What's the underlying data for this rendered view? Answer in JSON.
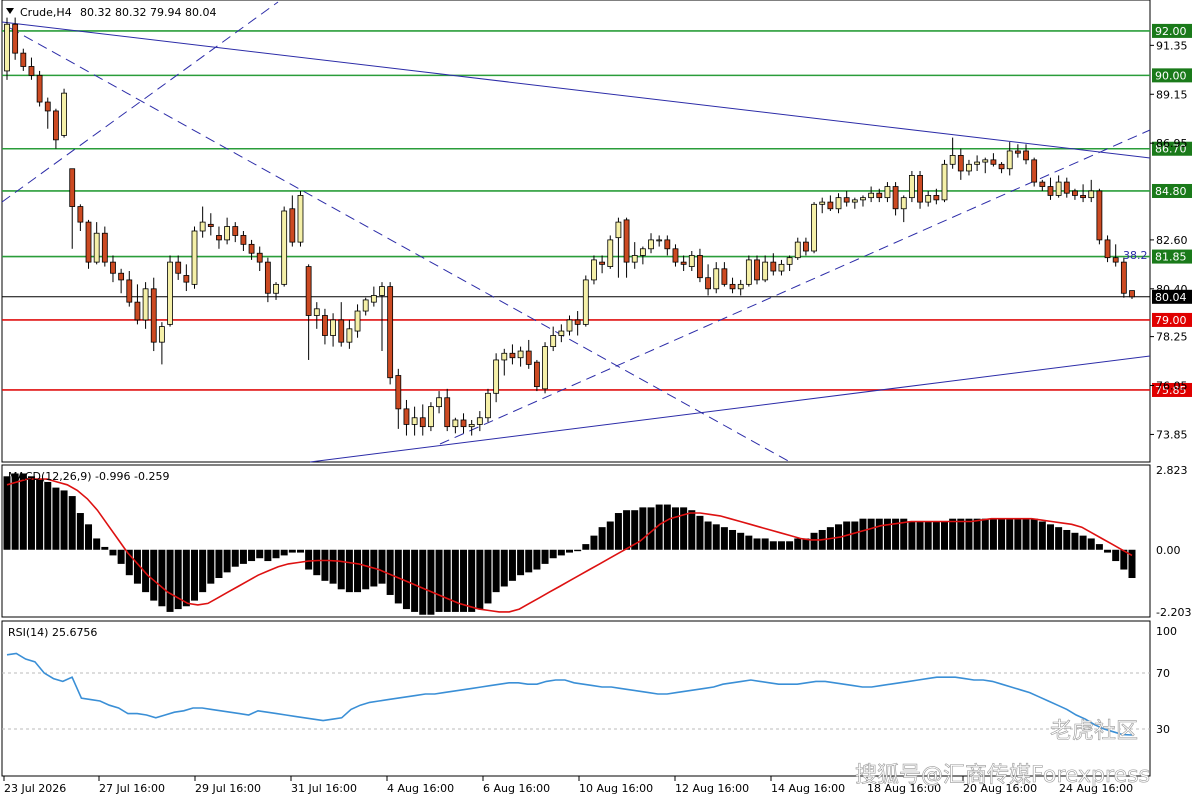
{
  "header": {
    "symbol": "Crude,H4",
    "ohlc": "80.32 80.32 79.94 80.04"
  },
  "colors": {
    "bull": "#f5f0a8",
    "bear": "#cc4a22",
    "support_line": "#2a9d3a",
    "resistance_line": "#e01010",
    "trend_line": "#2c2ca8",
    "macd_hist": "#000000",
    "macd_signal": "#dd1111",
    "rsi": "#3a8fd6",
    "price_tag_green": "#1a7a1a",
    "price_tag_red": "#e00000",
    "price_tag_current": "#000000"
  },
  "price_axis": {
    "ticks": [
      "91.35",
      "89.15",
      "86.95",
      "82.60",
      "80.40",
      "78.25",
      "76.05",
      "73.85"
    ],
    "levels": [
      {
        "label": "92.00",
        "value": 92.0,
        "kind": "green"
      },
      {
        "label": "90.00",
        "value": 90.0,
        "kind": "green"
      },
      {
        "label": "86.70",
        "value": 86.7,
        "kind": "green"
      },
      {
        "label": "84.80",
        "value": 84.8,
        "kind": "green"
      },
      {
        "label": "81.85",
        "value": 81.85,
        "kind": "green"
      },
      {
        "label": "80.04",
        "value": 80.04,
        "kind": "current"
      },
      {
        "label": "79.00",
        "value": 79.0,
        "kind": "red"
      },
      {
        "label": "75.85",
        "value": 75.85,
        "kind": "red"
      }
    ],
    "fib_label": "38.2"
  },
  "time_axis": [
    "23 Jul 2026",
    "27 Jul 16:00",
    "29 Jul 16:00",
    "31 Jul 16:00",
    "4 Aug 16:00",
    "6 Aug 16:00",
    "10 Aug 16:00",
    "12 Aug 16:00",
    "14 Aug 16:00",
    "18 Aug 16:00",
    "20 Aug 16:00",
    "24 Aug 16:00"
  ],
  "macd": {
    "label": "MACD(12,26,9) -0.996 -0.259",
    "ticks": [
      "2.823",
      "0.00",
      "-2.203"
    ]
  },
  "rsi": {
    "label": "RSI(14) 25.6756",
    "ticks": [
      "100",
      "70",
      "30"
    ]
  },
  "watermarks": {
    "right": "老虎社区",
    "bottom": "搜狐号@汇商传媒Forexpress"
  },
  "chart_data": {
    "type": "candlestick",
    "instrument": "Crude",
    "timeframe": "H4",
    "candles": [
      [
        90.2,
        92.6,
        89.8,
        92.3
      ],
      [
        92.3,
        92.6,
        90.7,
        91.0
      ],
      [
        91.0,
        91.2,
        90.2,
        90.4
      ],
      [
        90.4,
        90.8,
        89.8,
        90.0
      ],
      [
        90.0,
        90.2,
        88.6,
        88.8
      ],
      [
        88.8,
        89.0,
        87.6,
        88.4
      ],
      [
        88.4,
        88.5,
        86.7,
        87.1
      ],
      [
        87.3,
        89.4,
        87.2,
        89.2
      ],
      [
        85.8,
        85.8,
        82.2,
        84.1
      ],
      [
        84.1,
        84.2,
        83.0,
        83.4
      ],
      [
        83.4,
        83.5,
        81.3,
        81.6
      ],
      [
        81.6,
        83.4,
        81.5,
        82.9
      ],
      [
        82.9,
        83.2,
        81.4,
        81.6
      ],
      [
        81.6,
        81.9,
        80.7,
        81.1
      ],
      [
        81.1,
        81.3,
        80.2,
        80.8
      ],
      [
        80.8,
        81.2,
        79.6,
        79.8
      ],
      [
        79.8,
        80.6,
        78.8,
        79.0
      ],
      [
        79.0,
        80.7,
        78.6,
        80.4
      ],
      [
        80.4,
        80.9,
        77.6,
        78.0
      ],
      [
        78.0,
        78.9,
        77.0,
        78.7
      ],
      [
        78.8,
        81.9,
        78.7,
        81.6
      ],
      [
        81.6,
        81.9,
        80.8,
        81.1
      ],
      [
        81.0,
        81.5,
        80.3,
        80.7
      ],
      [
        80.6,
        83.2,
        80.4,
        83.0
      ],
      [
        83.0,
        84.1,
        82.7,
        83.4
      ],
      [
        83.3,
        83.8,
        82.8,
        83.2
      ],
      [
        82.8,
        83.2,
        82.2,
        82.6
      ],
      [
        82.6,
        83.6,
        82.4,
        83.2
      ],
      [
        83.2,
        83.4,
        82.5,
        82.8
      ],
      [
        82.8,
        83.0,
        82.1,
        82.4
      ],
      [
        82.4,
        82.6,
        81.7,
        82.0
      ],
      [
        82.0,
        82.3,
        81.2,
        81.6
      ],
      [
        81.6,
        81.8,
        79.8,
        80.2
      ],
      [
        80.2,
        80.7,
        79.9,
        80.6
      ],
      [
        80.6,
        84.1,
        80.5,
        83.9
      ],
      [
        84.0,
        84.6,
        82.3,
        82.5
      ],
      [
        82.5,
        84.8,
        82.3,
        84.6
      ],
      [
        81.4,
        81.5,
        77.2,
        79.2
      ],
      [
        79.2,
        79.8,
        78.6,
        79.5
      ],
      [
        79.2,
        79.5,
        77.9,
        78.3
      ],
      [
        78.3,
        79.3,
        77.8,
        79.0
      ],
      [
        79.0,
        79.8,
        77.8,
        78.0
      ],
      [
        78.0,
        79.0,
        77.7,
        78.6
      ],
      [
        78.5,
        79.7,
        78.2,
        79.4
      ],
      [
        79.4,
        80.0,
        79.2,
        79.9
      ],
      [
        79.8,
        80.5,
        79.6,
        80.1
      ],
      [
        80.1,
        80.7,
        77.6,
        80.5
      ],
      [
        80.5,
        80.7,
        76.1,
        76.4
      ],
      [
        76.5,
        76.8,
        74.1,
        75.0
      ],
      [
        75.0,
        75.4,
        73.8,
        74.3
      ],
      [
        74.3,
        75.1,
        73.8,
        74.6
      ],
      [
        74.6,
        75.2,
        73.8,
        74.2
      ],
      [
        74.2,
        75.3,
        74.0,
        75.1
      ],
      [
        75.1,
        75.8,
        74.8,
        75.5
      ],
      [
        75.5,
        75.9,
        74.0,
        74.2
      ],
      [
        74.2,
        74.6,
        73.9,
        74.5
      ],
      [
        74.5,
        74.8,
        73.9,
        74.2
      ],
      [
        74.2,
        74.5,
        73.8,
        74.3
      ],
      [
        74.3,
        74.9,
        74.0,
        74.6
      ],
      [
        74.6,
        75.9,
        74.4,
        75.7
      ],
      [
        75.7,
        77.5,
        75.3,
        77.2
      ],
      [
        77.2,
        77.7,
        76.5,
        77.5
      ],
      [
        77.5,
        77.9,
        77.0,
        77.3
      ],
      [
        77.3,
        77.8,
        76.9,
        77.6
      ],
      [
        77.6,
        78.1,
        76.8,
        77.0
      ],
      [
        77.1,
        77.2,
        75.8,
        76.0
      ],
      [
        75.9,
        78.0,
        75.7,
        77.8
      ],
      [
        77.8,
        78.7,
        77.6,
        78.3
      ],
      [
        78.3,
        78.8,
        78.0,
        78.5
      ],
      [
        78.5,
        79.2,
        78.3,
        79.0
      ],
      [
        79.0,
        79.4,
        78.3,
        78.8
      ],
      [
        78.8,
        81.0,
        78.7,
        80.8
      ],
      [
        80.8,
        81.9,
        80.6,
        81.7
      ],
      [
        81.6,
        81.9,
        81.1,
        81.5
      ],
      [
        81.4,
        82.8,
        81.3,
        82.6
      ],
      [
        82.7,
        83.6,
        80.9,
        83.4
      ],
      [
        83.5,
        83.6,
        80.9,
        81.6
      ],
      [
        81.6,
        82.5,
        81.3,
        81.9
      ],
      [
        81.9,
        82.3,
        81.5,
        82.2
      ],
      [
        82.2,
        82.9,
        82.0,
        82.6
      ],
      [
        82.6,
        82.8,
        82.3,
        82.6
      ],
      [
        82.6,
        82.8,
        81.9,
        82.2
      ],
      [
        82.2,
        82.4,
        81.4,
        81.6
      ],
      [
        81.6,
        81.9,
        81.2,
        81.5
      ],
      [
        81.4,
        82.1,
        81.2,
        81.9
      ],
      [
        81.9,
        82.2,
        80.7,
        80.9
      ],
      [
        80.9,
        81.5,
        80.1,
        80.4
      ],
      [
        80.4,
        81.6,
        80.2,
        81.3
      ],
      [
        81.3,
        81.6,
        80.5,
        80.6
      ],
      [
        80.6,
        80.9,
        80.2,
        80.4
      ],
      [
        80.4,
        80.8,
        80.1,
        80.6
      ],
      [
        80.6,
        81.9,
        80.5,
        81.7
      ],
      [
        81.7,
        81.9,
        80.6,
        80.8
      ],
      [
        80.8,
        81.9,
        80.7,
        81.6
      ],
      [
        81.6,
        82.0,
        81.0,
        81.2
      ],
      [
        81.2,
        81.7,
        81.0,
        81.5
      ],
      [
        81.5,
        81.9,
        81.2,
        81.8
      ],
      [
        81.8,
        82.7,
        81.7,
        82.5
      ],
      [
        82.5,
        82.7,
        81.9,
        82.1
      ],
      [
        82.1,
        84.3,
        82.0,
        84.2
      ],
      [
        84.2,
        84.5,
        83.8,
        84.3
      ],
      [
        84.3,
        84.6,
        83.9,
        84.0
      ],
      [
        84.0,
        84.7,
        83.8,
        84.5
      ],
      [
        84.5,
        84.8,
        84.1,
        84.3
      ],
      [
        84.3,
        84.5,
        84.0,
        84.4
      ],
      [
        84.4,
        84.6,
        84.1,
        84.5
      ],
      [
        84.5,
        85.0,
        84.3,
        84.7
      ],
      [
        84.7,
        84.9,
        84.3,
        84.5
      ],
      [
        84.5,
        85.2,
        84.3,
        85.0
      ],
      [
        85.0,
        85.2,
        83.7,
        84.0
      ],
      [
        84.0,
        84.6,
        83.4,
        84.5
      ],
      [
        84.5,
        85.7,
        84.3,
        85.5
      ],
      [
        85.5,
        85.7,
        84.0,
        84.3
      ],
      [
        84.3,
        84.8,
        84.1,
        84.6
      ],
      [
        84.6,
        84.9,
        84.2,
        84.4
      ],
      [
        84.4,
        86.2,
        84.3,
        86.0
      ],
      [
        86.0,
        87.2,
        85.8,
        86.4
      ],
      [
        86.4,
        86.7,
        85.3,
        85.7
      ],
      [
        85.7,
        86.2,
        85.5,
        86.0
      ],
      [
        86.0,
        86.4,
        85.7,
        86.1
      ],
      [
        86.1,
        86.3,
        85.6,
        86.2
      ],
      [
        86.2,
        86.5,
        85.9,
        86.0
      ],
      [
        86.0,
        86.1,
        85.6,
        85.8
      ],
      [
        85.8,
        87.0,
        85.5,
        86.6
      ],
      [
        86.6,
        86.9,
        86.3,
        86.5
      ],
      [
        86.6,
        86.9,
        86.0,
        86.2
      ],
      [
        86.2,
        86.3,
        85.0,
        85.2
      ],
      [
        85.2,
        85.3,
        84.8,
        85.0
      ],
      [
        85.0,
        85.4,
        84.4,
        84.6
      ],
      [
        84.6,
        85.5,
        84.5,
        85.2
      ],
      [
        85.2,
        85.4,
        84.5,
        84.7
      ],
      [
        84.8,
        84.9,
        84.4,
        84.6
      ],
      [
        84.6,
        85.1,
        84.3,
        84.5
      ],
      [
        84.5,
        85.3,
        84.3,
        84.8
      ],
      [
        84.8,
        84.9,
        82.4,
        82.6
      ],
      [
        82.6,
        82.8,
        81.6,
        81.8
      ],
      [
        81.8,
        82.4,
        81.4,
        81.6
      ],
      [
        81.6,
        81.8,
        80.0,
        80.2
      ],
      [
        80.32,
        80.32,
        79.94,
        80.04
      ]
    ],
    "macd_histogram": [
      2.6,
      2.7,
      2.7,
      2.6,
      2.5,
      2.4,
      2.2,
      2.1,
      1.9,
      1.3,
      0.9,
      0.4,
      0.1,
      -0.2,
      -0.5,
      -0.9,
      -1.2,
      -1.5,
      -1.8,
      -2.0,
      -2.2,
      -2.1,
      -2.0,
      -1.8,
      -1.5,
      -1.2,
      -1.0,
      -0.8,
      -0.6,
      -0.5,
      -0.4,
      -0.3,
      -0.4,
      -0.3,
      -0.2,
      -0.1,
      -0.1,
      -0.7,
      -0.9,
      -1.1,
      -1.2,
      -1.4,
      -1.5,
      -1.5,
      -1.4,
      -1.3,
      -1.2,
      -1.6,
      -1.9,
      -2.1,
      -2.2,
      -2.3,
      -2.3,
      -2.2,
      -2.2,
      -2.2,
      -2.2,
      -2.2,
      -2.1,
      -1.9,
      -1.5,
      -1.3,
      -1.1,
      -0.9,
      -0.8,
      -0.7,
      -0.5,
      -0.3,
      -0.2,
      -0.1,
      -0.05,
      0.2,
      0.5,
      0.8,
      1.0,
      1.3,
      1.4,
      1.4,
      1.5,
      1.5,
      1.6,
      1.6,
      1.5,
      1.5,
      1.4,
      1.2,
      1.0,
      0.9,
      0.8,
      0.7,
      0.6,
      0.5,
      0.4,
      0.4,
      0.3,
      0.3,
      0.3,
      0.4,
      0.4,
      0.6,
      0.7,
      0.8,
      0.9,
      1.0,
      1.0,
      1.1,
      1.1,
      1.1,
      1.1,
      1.1,
      1.1,
      1.0,
      1.0,
      1.0,
      1.0,
      1.0,
      1.1,
      1.1,
      1.1,
      1.1,
      1.1,
      1.1,
      1.1,
      1.1,
      1.1,
      1.1,
      1.1,
      1.0,
      0.9,
      0.8,
      0.7,
      0.6,
      0.5,
      0.4,
      0.2,
      -0.1,
      -0.4,
      -0.7,
      -1.0
    ],
    "macd_signal": [
      2.3,
      2.4,
      2.5,
      2.5,
      2.5,
      2.4,
      2.3,
      2.1,
      1.8,
      1.4,
      0.9,
      0.4,
      -0.1,
      -0.5,
      -0.9,
      -1.2,
      -1.5,
      -1.7,
      -1.9,
      -1.95,
      -1.9,
      -1.7,
      -1.5,
      -1.3,
      -1.1,
      -0.9,
      -0.75,
      -0.6,
      -0.5,
      -0.45,
      -0.4,
      -0.38,
      -0.38,
      -0.4,
      -0.45,
      -0.5,
      -0.6,
      -0.7,
      -0.85,
      -1.0,
      -1.15,
      -1.3,
      -1.45,
      -1.6,
      -1.75,
      -1.9,
      -2.0,
      -2.1,
      -2.15,
      -2.2,
      -2.2,
      -2.1,
      -1.9,
      -1.7,
      -1.5,
      -1.3,
      -1.1,
      -0.9,
      -0.7,
      -0.5,
      -0.3,
      -0.1,
      0.1,
      0.3,
      0.6,
      0.9,
      1.1,
      1.2,
      1.3,
      1.3,
      1.25,
      1.2,
      1.1,
      1.0,
      0.9,
      0.8,
      0.7,
      0.6,
      0.5,
      0.4,
      0.35,
      0.35,
      0.4,
      0.45,
      0.55,
      0.65,
      0.75,
      0.85,
      0.9,
      0.95,
      1.0,
      1.0,
      1.0,
      1.0,
      1.0,
      1.0,
      1.0,
      1.05,
      1.1,
      1.1,
      1.1,
      1.1,
      1.1,
      1.05,
      1.0,
      0.95,
      0.9,
      0.8,
      0.6,
      0.4,
      0.2,
      0.0,
      -0.2
    ],
    "rsi": [
      83,
      84,
      80,
      78,
      70,
      66,
      64,
      67,
      52,
      51,
      50,
      47,
      45,
      41,
      41,
      40,
      38,
      40,
      42,
      43,
      45,
      45,
      44,
      43,
      42,
      41,
      40,
      43,
      42,
      41,
      40,
      39,
      38,
      37,
      36,
      37,
      38,
      44,
      47,
      49,
      50,
      51,
      52,
      53,
      54,
      55,
      55,
      56,
      57,
      58,
      59,
      60,
      61,
      62,
      63,
      63,
      62,
      62,
      64,
      65,
      65,
      63,
      62,
      61,
      60,
      60,
      59,
      58,
      57,
      56,
      55,
      55,
      56,
      57,
      58,
      59,
      60,
      62,
      63,
      64,
      65,
      64,
      63,
      62,
      62,
      62,
      63,
      64,
      64,
      63,
      62,
      61,
      60,
      60,
      61,
      62,
      63,
      64,
      65,
      66,
      67,
      67,
      67,
      66,
      65,
      65,
      64,
      62,
      60,
      58,
      56,
      53,
      50,
      47,
      44,
      40,
      37,
      33,
      30,
      28,
      26,
      25.7
    ],
    "macd_range": [
      -2.203,
      2.823
    ],
    "rsi_range": [
      0,
      100
    ]
  }
}
